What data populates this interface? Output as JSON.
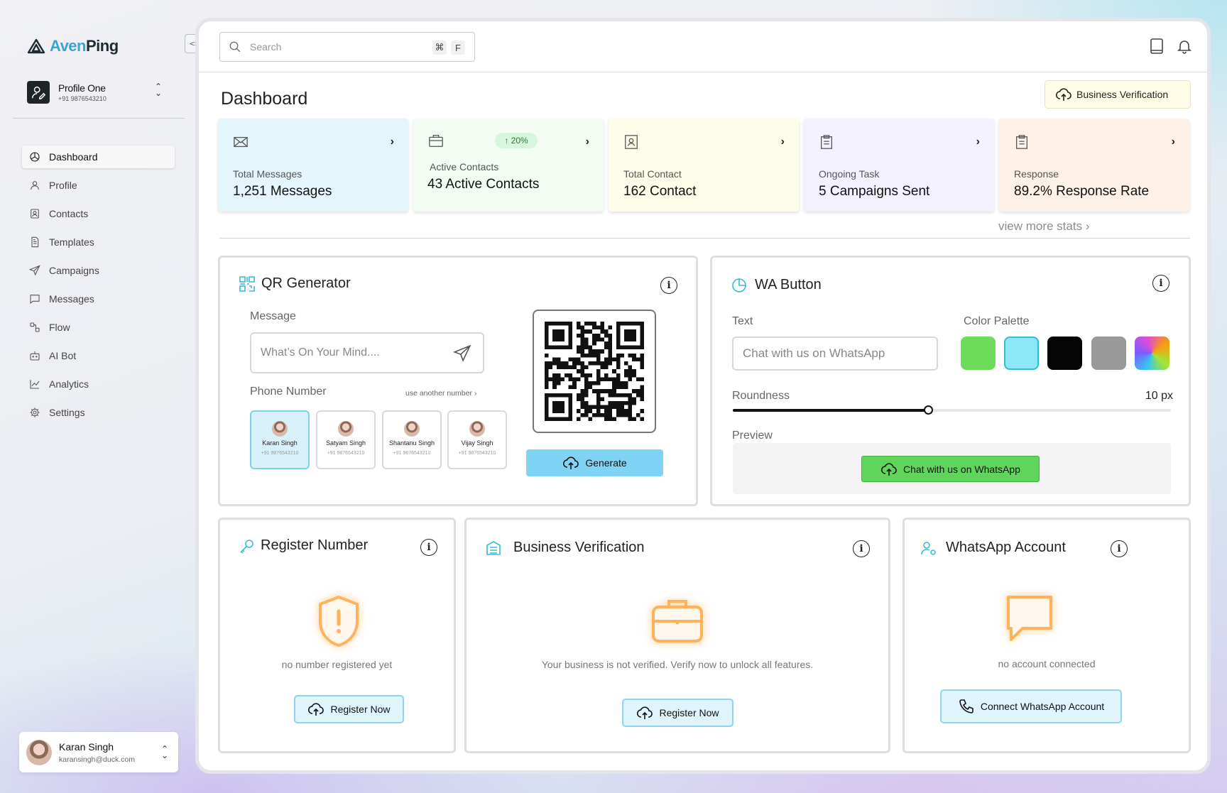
{
  "app": {
    "brand_part1": "Aven",
    "brand_part2": "Ping"
  },
  "profile": {
    "name": "Profile One",
    "phone": "+91 9876543210"
  },
  "nav": [
    {
      "label": "Dashboard",
      "icon": "dashboard-icon",
      "active": true
    },
    {
      "label": "Profile",
      "icon": "user-icon"
    },
    {
      "label": "Contacts",
      "icon": "contacts-icon"
    },
    {
      "label": "Templates",
      "icon": "document-icon"
    },
    {
      "label": "Campaigns",
      "icon": "send-icon"
    },
    {
      "label": "Messages",
      "icon": "chat-icon"
    },
    {
      "label": "Flow",
      "icon": "flow-icon"
    },
    {
      "label": "AI Bot",
      "icon": "bot-icon"
    },
    {
      "label": "Analytics",
      "icon": "analytics-icon"
    },
    {
      "label": "Settings",
      "icon": "gear-icon"
    }
  ],
  "user": {
    "name": "Karan Singh",
    "email": "karansingh@duck.com"
  },
  "search": {
    "placeholder": "Search",
    "key1": "⌘",
    "key2": "F"
  },
  "page": {
    "title": "Dashboard",
    "business_verification_button": "Business Verification"
  },
  "stats": [
    {
      "label": "Total Messages",
      "value": "1,251 Messages",
      "color": "#e4f5fb",
      "icon": "mail-icon"
    },
    {
      "label": "Active Contacts",
      "value": "43 Active Contacts",
      "color": "#f3fcf2",
      "icon": "briefcase-icon",
      "badge": "20%"
    },
    {
      "label": "Total Contact",
      "value": "162 Contact",
      "color": "#fefde9",
      "icon": "contact-book-icon"
    },
    {
      "label": "Ongoing Task",
      "value": "5 Campaigns Sent",
      "color": "#f3f1fd",
      "icon": "clipboard-icon"
    },
    {
      "label": "Response",
      "value": "89.2% Response Rate",
      "color": "#fdf1e8",
      "icon": "clipboard-icon"
    }
  ],
  "view_more": "view more stats",
  "qr": {
    "title": "QR Generator",
    "message_label": "Message",
    "message_placeholder": "What’s On Your Mind....",
    "phone_label": "Phone Number",
    "another_number": "use another number",
    "contacts": [
      {
        "name": "Karan Singh",
        "phone": "+91 9876543210",
        "selected": true
      },
      {
        "name": "Satyam Singh",
        "phone": "+91 9876543210"
      },
      {
        "name": "Shantanu Singh",
        "phone": "+91 9876543210"
      },
      {
        "name": "Vijay Singh",
        "phone": "+91 9876543210"
      }
    ],
    "generate_label": "Generate"
  },
  "wa_button": {
    "title": "WA Button",
    "text_label": "Text",
    "text_value": "Chat with us on WhatsApp",
    "palette_label": "Color Palette",
    "palette": [
      "#6ddc5a",
      "#8ce8f4",
      "#050505",
      "#999999",
      "gradient"
    ],
    "roundness_label": "Roundness",
    "roundness_value": "10 px",
    "roundness_fraction": 0.445,
    "preview_label": "Preview",
    "preview_button": "Chat with us on WhatsApp"
  },
  "register": {
    "title": "Register Number",
    "empty": "no number registered yet",
    "button": "Register Now"
  },
  "business": {
    "title": "Business Verification",
    "empty": "Your business is not verified. Verify now to unlock all features.",
    "button": "Register Now"
  },
  "whatsapp": {
    "title": "WhatsApp Account",
    "empty": "no account connected",
    "button": "Connect WhatsApp Account"
  }
}
